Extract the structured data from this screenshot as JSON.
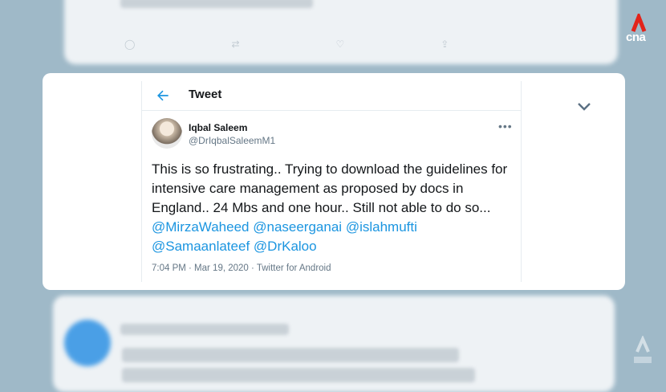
{
  "header": {
    "title": "Tweet"
  },
  "tweet": {
    "display_name": "Iqbal Saleem",
    "handle": "@DrIqbalSaleemM1",
    "more_label": "•••",
    "text_plain": "This is so frustrating.. Trying to download the guidelines for intensive care management as proposed by docs in England.. 24 Mbs and one hour.. Still not able to do so...",
    "mentions": [
      "@MirzaWaheed",
      "@naseerganai",
      "@islahmufti",
      "@Samaanlateef",
      "@DrKaloo"
    ],
    "timestamp": "7:04 PM · Mar 19, 2020 · Twitter for Android"
  },
  "logo": {
    "text": "cna"
  },
  "colors": {
    "accent": "#1b95e0",
    "brand_red": "#e2231a"
  },
  "icons": {
    "back": "back-arrow-icon",
    "chevron": "chevron-down-icon",
    "more": "more-dots-icon"
  }
}
